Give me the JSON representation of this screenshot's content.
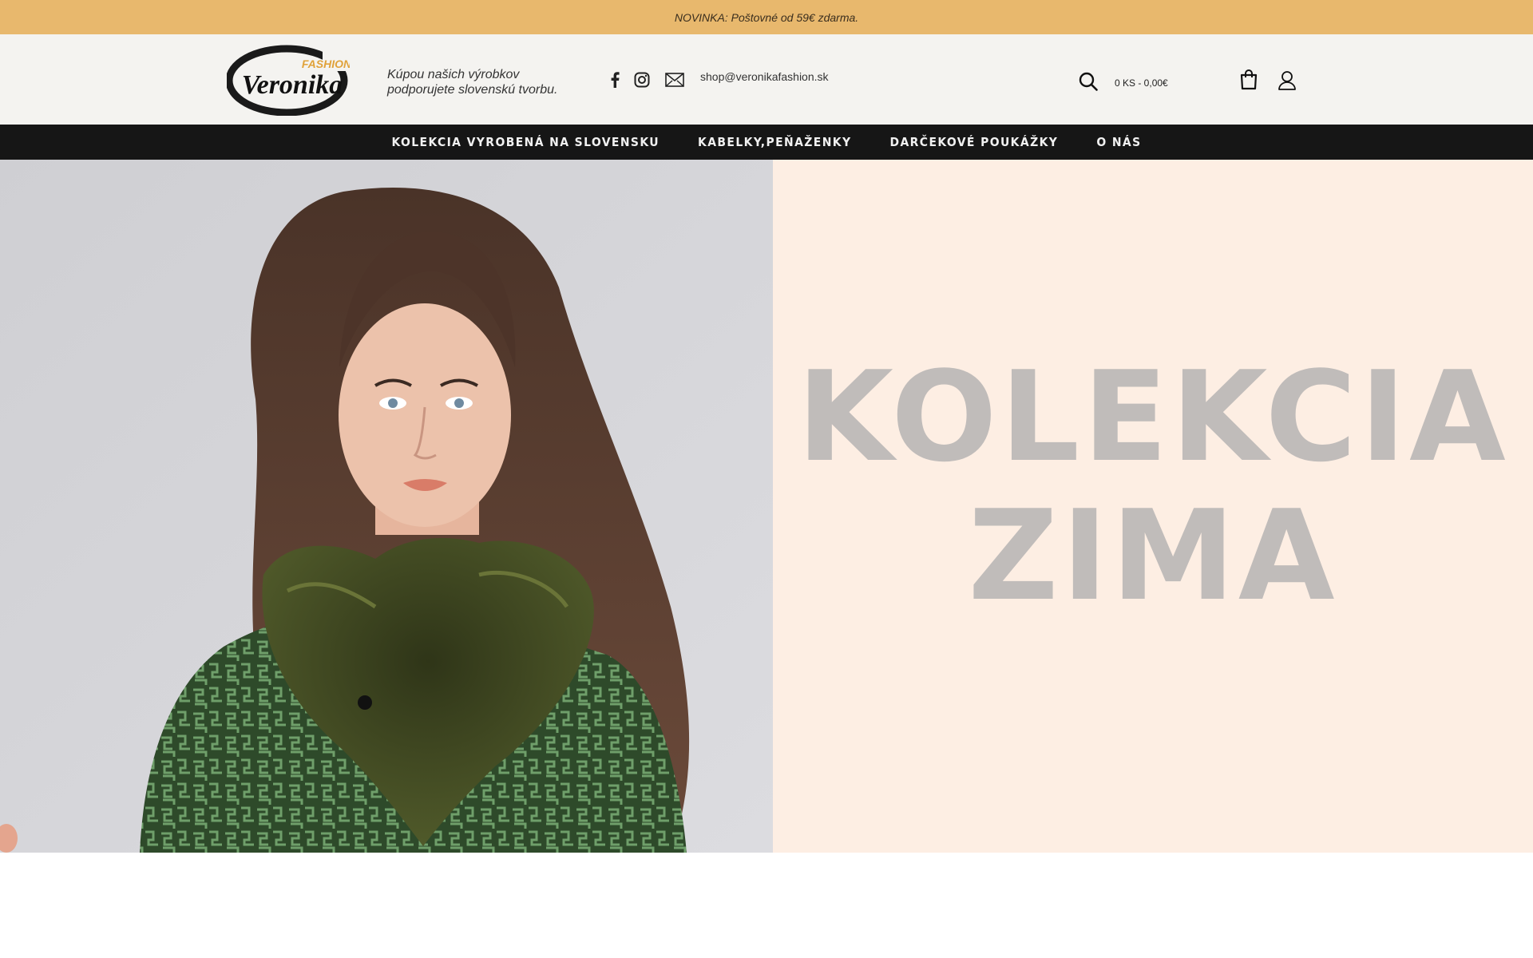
{
  "promo": {
    "text": "NOVINKA: Poštovné od 59€ zdarma."
  },
  "header": {
    "logo": {
      "main": "Veronika",
      "sub": "FASHION"
    },
    "tagline": "Kúpou našich výrobkov podporujete slovenskú tvorbu.",
    "social": [
      "facebook-icon",
      "instagram-icon",
      "mail-icon"
    ],
    "email": "shop@veronikafashion.sk",
    "cart_summary": "0 KS - 0,00€",
    "icons": [
      "search-icon",
      "shopping-bag-icon",
      "user-icon"
    ]
  },
  "nav": {
    "items": [
      {
        "label": "KOLEKCIA VYROBENÁ NA SLOVENSKU"
      },
      {
        "label": "KABELKY,PEŇAŽENKY"
      },
      {
        "label": "DARČEKOVÉ POUKÁŽKY"
      },
      {
        "label": "O NÁS"
      }
    ]
  },
  "hero": {
    "title_line1": "KOLEKCIA",
    "title_line2": "ZIMA"
  },
  "colors": {
    "promo_bg": "#e8b86d",
    "header_bg": "#f4f3f0",
    "nav_bg": "#161616",
    "hero_panel_bg": "#fdeee3",
    "hero_title": "#c0bcba"
  }
}
